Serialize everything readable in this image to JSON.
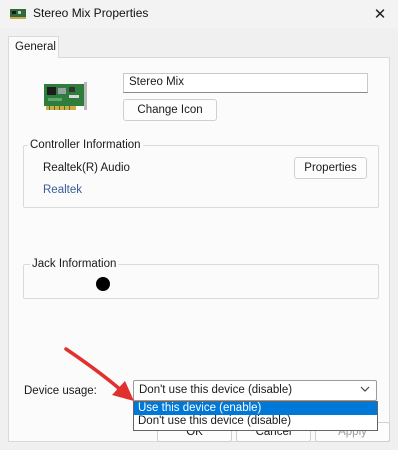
{
  "window": {
    "title": "Stereo Mix Properties",
    "close_glyph": "✕",
    "icon": "sound-card-icon"
  },
  "tabs": [
    {
      "label": "General",
      "active": true
    }
  ],
  "device": {
    "name": "Stereo Mix",
    "change_icon_label": "Change Icon",
    "icon": "pci-sound-card-icon"
  },
  "controller": {
    "group_label": "Controller Information",
    "name": "Realtek(R) Audio",
    "vendor": "Realtek",
    "properties_label": "Properties"
  },
  "jack": {
    "group_label": "Jack Information",
    "color": "#000000"
  },
  "usage": {
    "label": "Device usage:",
    "selected": "Don't use this device (disable)",
    "options": [
      {
        "label": "Use this device (enable)",
        "highlighted": true
      },
      {
        "label": "Don't use this device (disable)",
        "highlighted": false
      }
    ]
  },
  "footer": {
    "ok_label": "OK",
    "cancel_label": "Cancel",
    "apply_label": "Apply"
  },
  "colors": {
    "highlight": "#0078d7",
    "annotation_arrow": "#e0312f",
    "vendor_link": "#3a5b9a"
  }
}
